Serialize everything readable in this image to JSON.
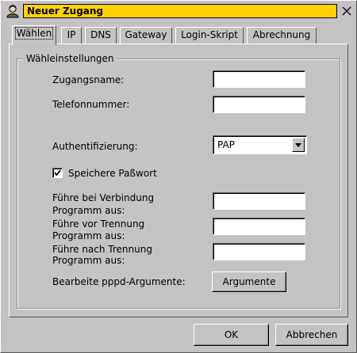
{
  "window": {
    "title": "Neuer Zugang"
  },
  "icons": {
    "app": "user-icon",
    "close": "close-icon"
  },
  "tabs": [
    {
      "label": "Wählen",
      "active": true
    },
    {
      "label": "IP"
    },
    {
      "label": "DNS"
    },
    {
      "label": "Gateway"
    },
    {
      "label": "Login-Skript"
    },
    {
      "label": "Abrechnung"
    }
  ],
  "group": {
    "title": "Wähleinstellungen",
    "account_name_label": "Zugangsname:",
    "account_name_value": "",
    "phone_label": "Telefonnummer:",
    "phone_value": "",
    "auth_label": "Authentifizierung:",
    "auth_value": "PAP",
    "save_password_label": "Speichere Paßwort",
    "save_password_checked": true,
    "on_connect_label_1": "Führe bei Verbindung",
    "on_connect_label_2": "Programm aus:",
    "before_disconnect_label_1": "Führe vor Trennung",
    "before_disconnect_label_2": "Programm aus:",
    "after_disconnect_label_1": "Führe nach Trennung",
    "after_disconnect_label_2": "Programm aus:",
    "pppd_label": "Bearbeite pppd-Argumente:",
    "pppd_button": "Argumente"
  },
  "footer": {
    "ok": "OK",
    "cancel": "Abbrechen"
  }
}
